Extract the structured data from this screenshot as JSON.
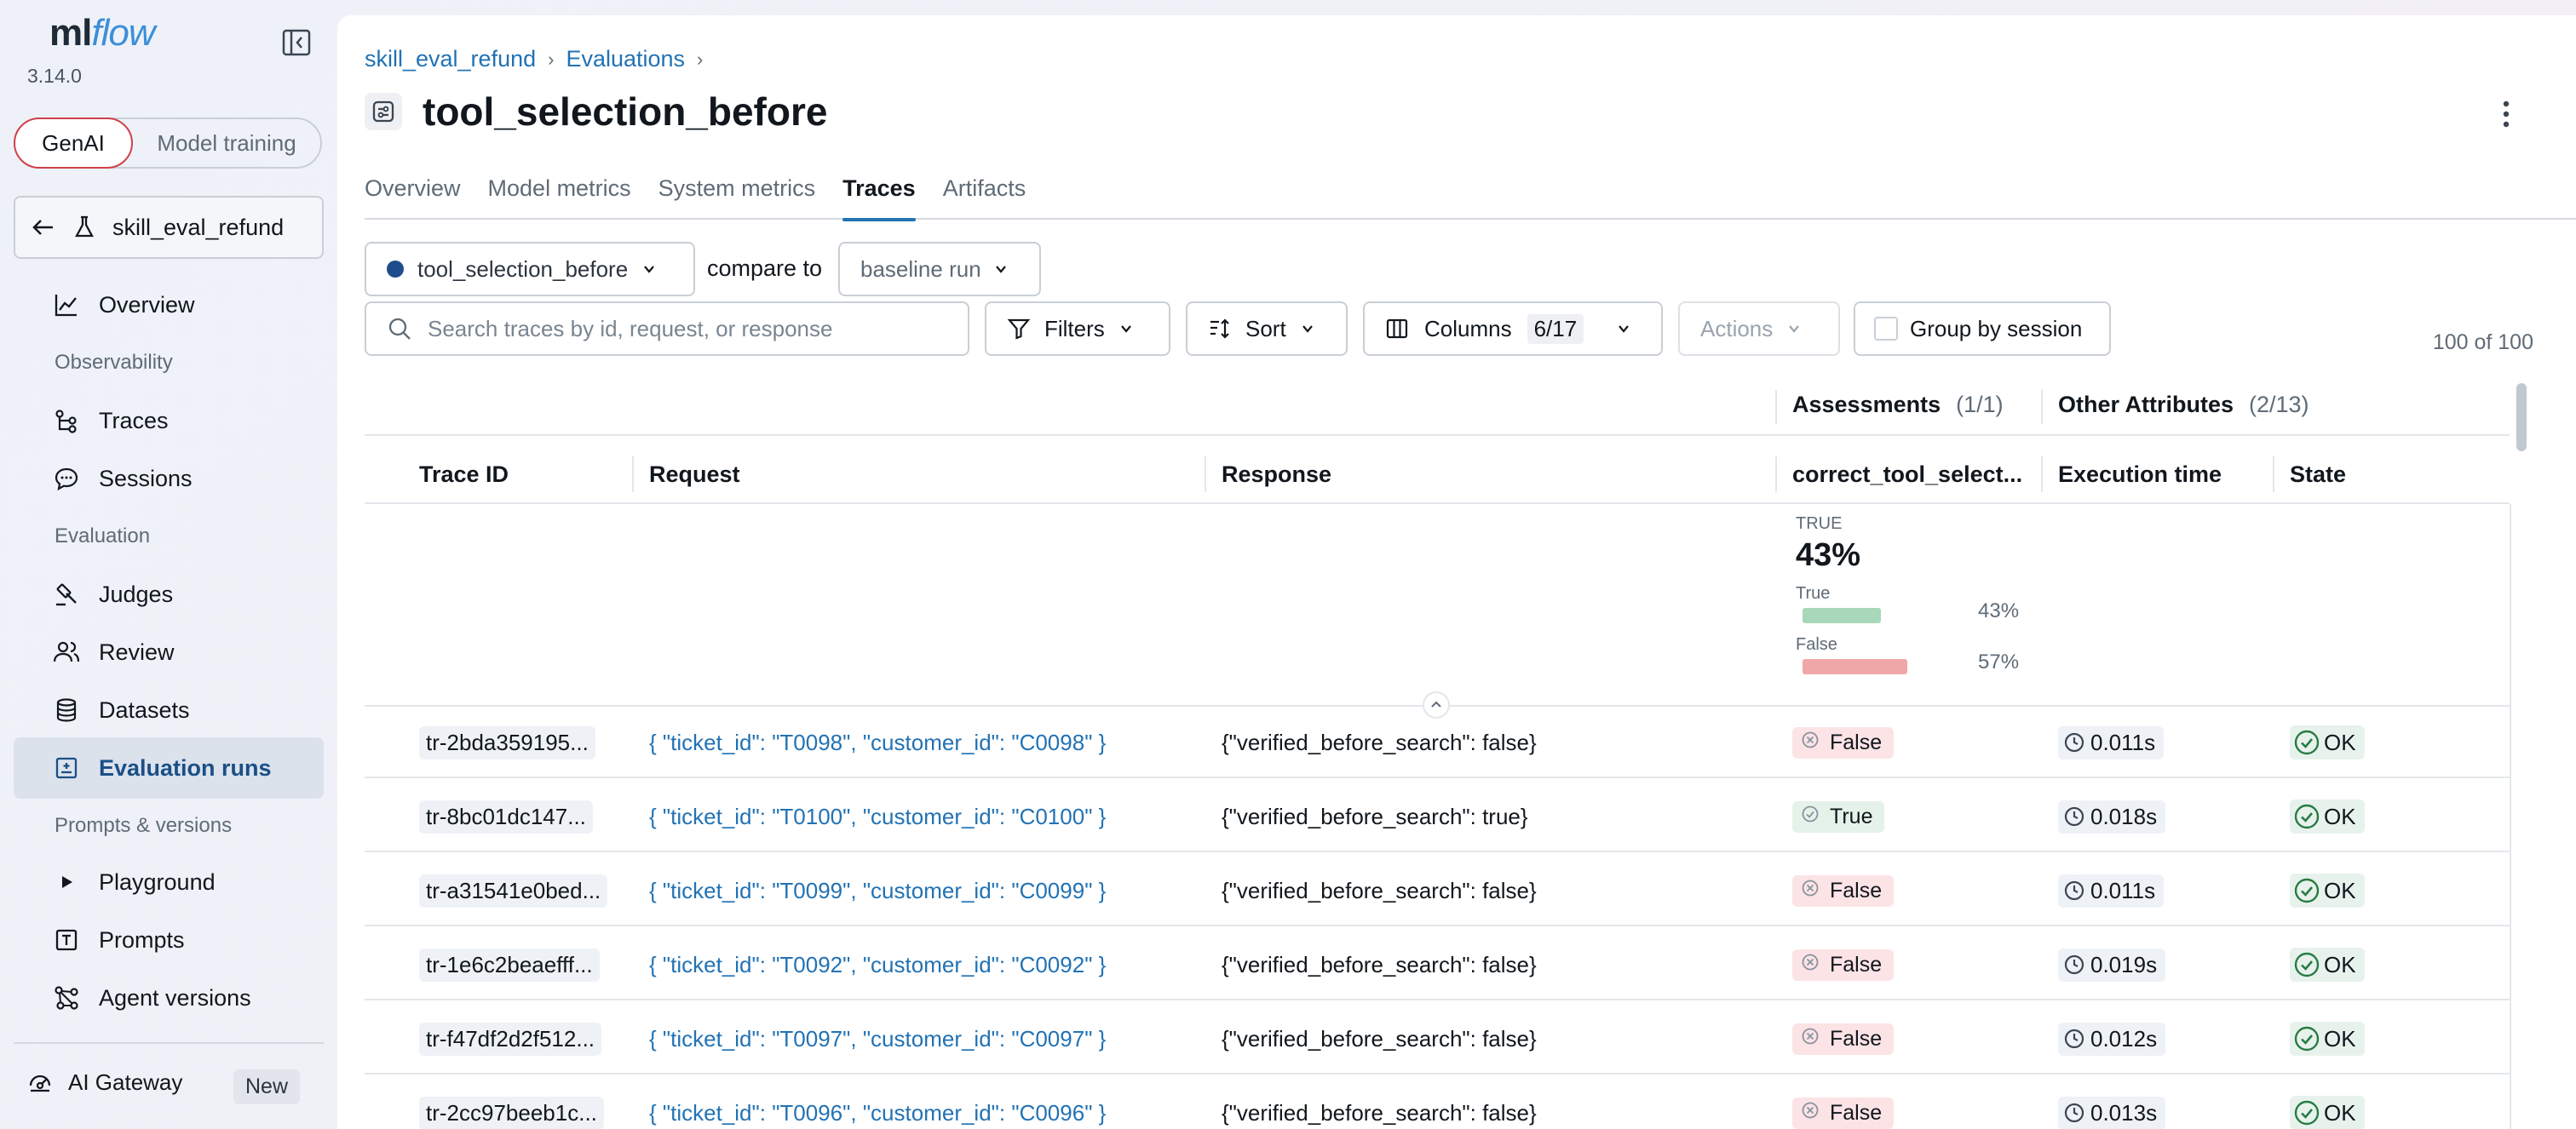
{
  "sidebar": {
    "logo": {
      "ml": "ml",
      "flow": "flow"
    },
    "version": "3.14.0",
    "modes": {
      "active": "GenAI",
      "inactive": "Model training"
    },
    "experiment": "skill_eval_refund",
    "items": {
      "overview": "Overview",
      "traces": "Traces",
      "sessions": "Sessions",
      "judges": "Judges",
      "review": "Review",
      "datasets": "Datasets",
      "evaluation_runs": "Evaluation runs",
      "playground": "Playground",
      "prompts": "Prompts",
      "agent_versions": "Agent versions"
    },
    "sections": {
      "observability": "Observability",
      "evaluation": "Evaluation",
      "prompts_versions": "Prompts & versions"
    },
    "gateway": {
      "label": "AI Gateway",
      "badge": "New"
    }
  },
  "breadcrumb": {
    "first": "skill_eval_refund",
    "second": "Evaluations"
  },
  "page_title": "tool_selection_before",
  "tabs": [
    "Overview",
    "Model metrics",
    "System metrics",
    "Traces",
    "Artifacts"
  ],
  "toolbar": {
    "run": "tool_selection_before",
    "compare_label": "compare to",
    "baseline": "baseline run",
    "search_placeholder": "Search traces by id, request, or response",
    "filters": "Filters",
    "sort": "Sort",
    "columns": "Columns",
    "columns_count": "6/17",
    "actions": "Actions",
    "group_by_session": "Group by session",
    "row_count": "100 of 100"
  },
  "table": {
    "groups": {
      "assessments": {
        "label": "Assessments",
        "count": "(1/1)"
      },
      "other": {
        "label": "Other Attributes",
        "count": "(2/13)"
      }
    },
    "columns": {
      "trace_id": "Trace ID",
      "request": "Request",
      "response": "Response",
      "assessment": "correct_tool_select...",
      "exec": "Execution time",
      "state": "State"
    },
    "summary": {
      "label": "TRUE",
      "value": "43%",
      "true_label": "True",
      "true_pct": "43%",
      "true_fraction": 0.43,
      "false_label": "False",
      "false_pct": "57%",
      "false_fraction": 0.57
    },
    "rows": [
      {
        "id": "tr-2bda359195...",
        "request": "{ \"ticket_id\": \"T0098\", \"customer_id\": \"C0098\" }",
        "response": "{\"verified_before_search\": false}",
        "assessment": "False",
        "exec": "0.011s",
        "state": "OK"
      },
      {
        "id": "tr-8bc01dc147...",
        "request": "{ \"ticket_id\": \"T0100\", \"customer_id\": \"C0100\" }",
        "response": "{\"verified_before_search\": true}",
        "assessment": "True",
        "exec": "0.018s",
        "state": "OK"
      },
      {
        "id": "tr-a31541e0bed...",
        "request": "{ \"ticket_id\": \"T0099\", \"customer_id\": \"C0099\" }",
        "response": "{\"verified_before_search\": false}",
        "assessment": "False",
        "exec": "0.011s",
        "state": "OK"
      },
      {
        "id": "tr-1e6c2beaefff...",
        "request": "{ \"ticket_id\": \"T0092\", \"customer_id\": \"C0092\" }",
        "response": "{\"verified_before_search\": false}",
        "assessment": "False",
        "exec": "0.019s",
        "state": "OK"
      },
      {
        "id": "tr-f47df2d2f512...",
        "request": "{ \"ticket_id\": \"T0097\", \"customer_id\": \"C0097\" }",
        "response": "{\"verified_before_search\": false}",
        "assessment": "False",
        "exec": "0.012s",
        "state": "OK"
      },
      {
        "id": "tr-2cc97beeb1c...",
        "request": "{ \"ticket_id\": \"T0096\", \"customer_id\": \"C0096\" }",
        "response": "{\"verified_before_search\": false}",
        "assessment": "False",
        "exec": "0.013s",
        "state": "OK"
      }
    ]
  }
}
